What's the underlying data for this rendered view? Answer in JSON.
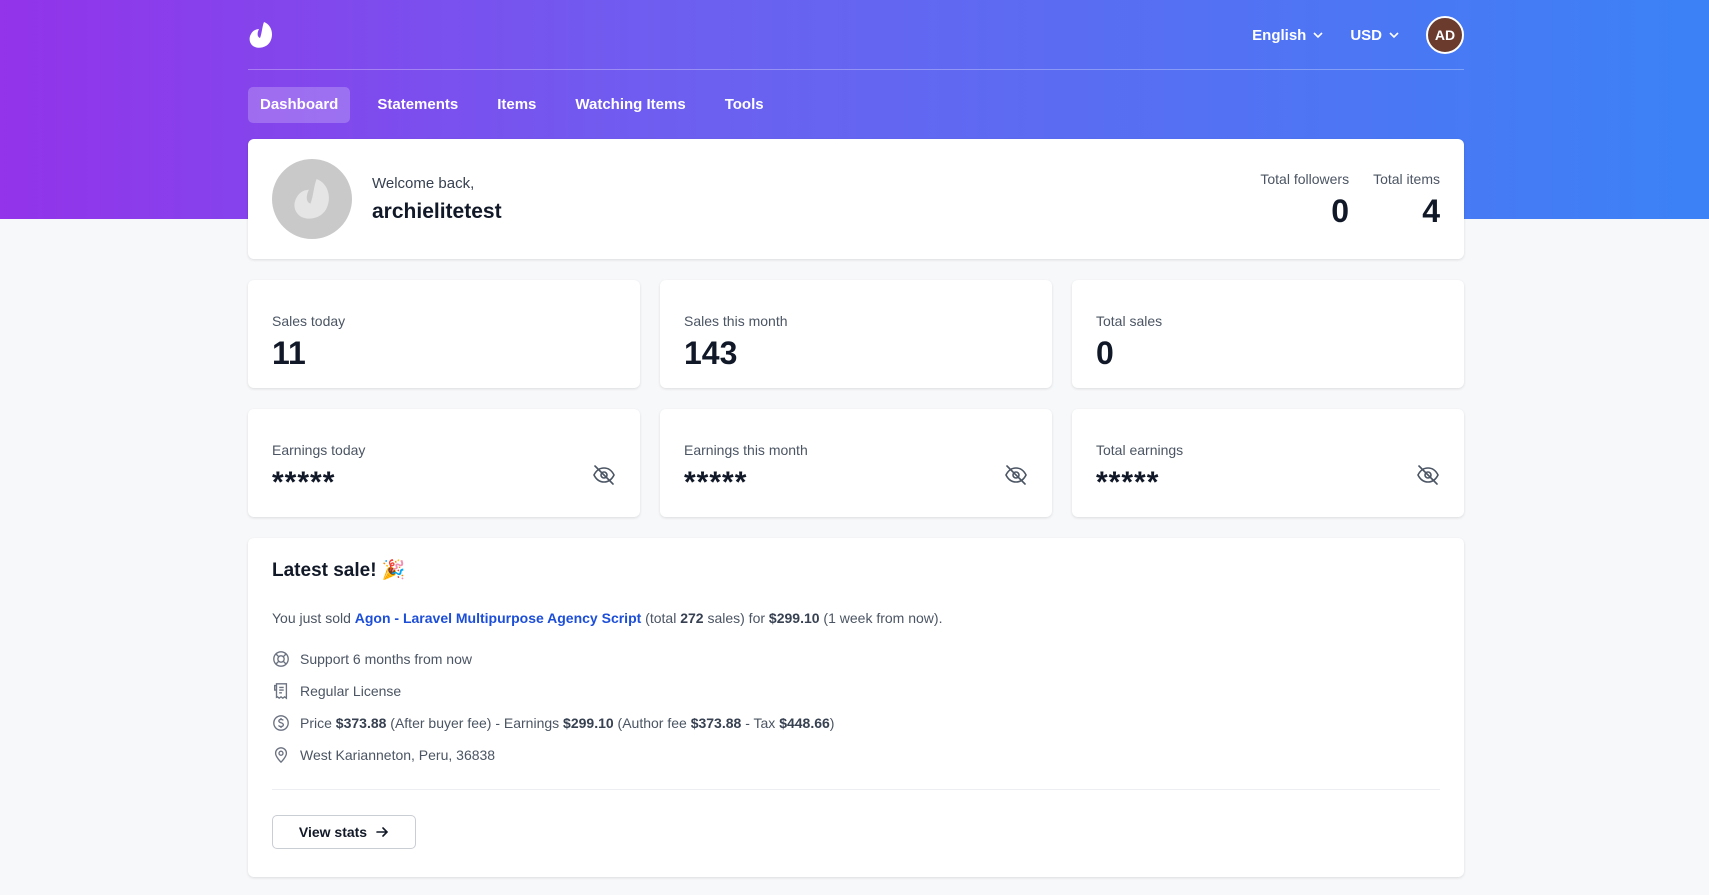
{
  "header": {
    "language": "English",
    "currency": "USD",
    "avatar_initials": "AD"
  },
  "nav": [
    {
      "label": "Dashboard",
      "active": true
    },
    {
      "label": "Statements",
      "active": false
    },
    {
      "label": "Items",
      "active": false
    },
    {
      "label": "Watching Items",
      "active": false
    },
    {
      "label": "Tools",
      "active": false
    }
  ],
  "welcome": {
    "greeting": "Welcome back,",
    "username": "archielitetest",
    "followers_label": "Total followers",
    "followers_value": "0",
    "items_label": "Total items",
    "items_value": "4"
  },
  "sales": {
    "today_label": "Sales today",
    "today_value": "11",
    "month_label": "Sales this month",
    "month_value": "143",
    "total_label": "Total sales",
    "total_value": "0"
  },
  "earnings": {
    "today_label": "Earnings today",
    "today_value": "*****",
    "month_label": "Earnings this month",
    "month_value": "*****",
    "total_label": "Total earnings",
    "total_value": "*****"
  },
  "latest_sale": {
    "title": "Latest sale! 🎉",
    "prefix": "You just sold ",
    "item_name": "Agon - Laravel Multipurpose Agency Script",
    "total_open": " (total ",
    "total_sales": "272",
    "sales_for": " sales) for ",
    "amount": "$299.10",
    "when": " (1 week from now).",
    "support": "Support 6 months from now",
    "license": "Regular License",
    "price_label": "Price ",
    "price": "$373.88",
    "after_fee": " (After buyer fee) - Earnings ",
    "earnings": "$299.10",
    "author_fee_label": " (Author fee ",
    "author_fee": "$373.88",
    "tax_label": " - Tax ",
    "tax": "$448.66",
    "close_paren": ")",
    "location": "West Karianneton, Peru, 36838",
    "button": "View stats"
  },
  "colors": {
    "gradient_start": "#9333ea",
    "gradient_end": "#3b82f6",
    "link": "#1d4ed8"
  }
}
